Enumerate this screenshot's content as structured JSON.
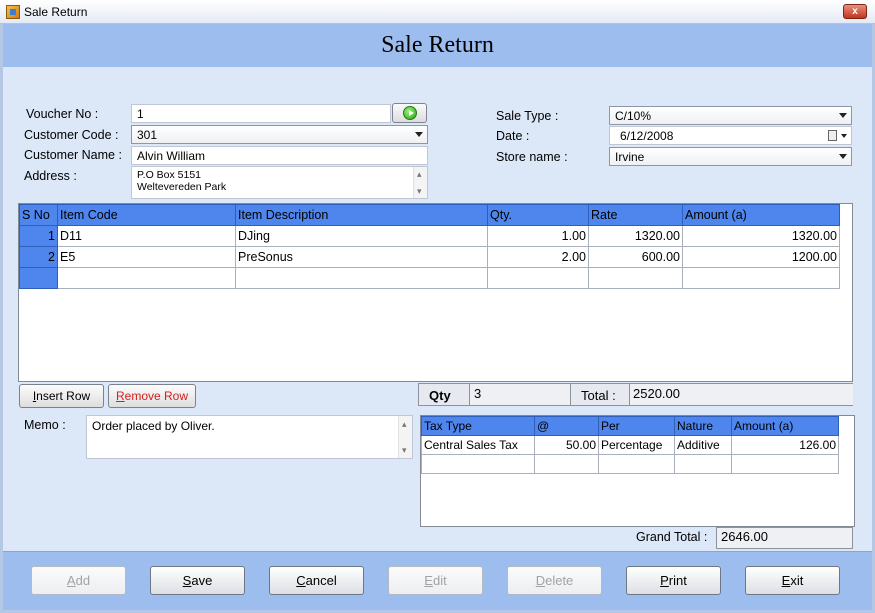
{
  "window": {
    "title": "Sale Return",
    "close_label": "x"
  },
  "form": {
    "title": "Sale Return"
  },
  "left_fields": {
    "voucher_label": "Voucher No :",
    "voucher_value": "1",
    "customer_code_label": "Customer Code :",
    "customer_code_value": "301",
    "customer_name_label": "Customer Name :",
    "customer_name_value": "Alvin William",
    "address_label": "Address :",
    "address_line1": "P.O Box 5151",
    "address_line2": "Weltevereden Park"
  },
  "right_fields": {
    "sale_type_label": "Sale Type :",
    "sale_type_value": "C/10%",
    "date_label": "Date :",
    "date_value": "6/12/2008",
    "store_label": "Store name :",
    "store_value": "Irvine"
  },
  "items": {
    "headers": [
      "S No",
      "Item Code",
      "Item Description",
      "Qty.",
      "Rate",
      "Amount (a)"
    ],
    "rows": [
      {
        "sno": "1",
        "code": "D11",
        "desc": "DJing",
        "qty": "1.00",
        "rate": "1320.00",
        "amount": "1320.00"
      },
      {
        "sno": "2",
        "code": "E5",
        "desc": "PreSonus",
        "qty": "2.00",
        "rate": "600.00",
        "amount": "1200.00"
      }
    ]
  },
  "row_buttons": {
    "insert": "Insert Row",
    "remove": "Remove Row"
  },
  "summary": {
    "qty_label": "Qty",
    "qty_value": "3",
    "total_label": "Total :",
    "total_value": "2520.00"
  },
  "memo": {
    "label": "Memo :",
    "value": "Order placed by Oliver."
  },
  "tax": {
    "headers": [
      "Tax Type",
      "@",
      "Per",
      "Nature",
      "Amount (a)"
    ],
    "rows": [
      {
        "type": "Central Sales Tax",
        "at": "50.00",
        "per": "Percentage",
        "nature": "Additive",
        "amount": "126.00"
      }
    ]
  },
  "grand_total": {
    "label": "Grand Total :",
    "value": "2646.00"
  },
  "actions": {
    "add": "Add",
    "save": "Save",
    "cancel": "Cancel",
    "edit": "Edit",
    "delete": "Delete",
    "print": "Print",
    "exit": "Exit"
  },
  "colors": {
    "header_blue": "#9dbdef",
    "grid_header": "#4e86ee",
    "frame": "#dce8f8",
    "remove_text": "#d42020"
  }
}
